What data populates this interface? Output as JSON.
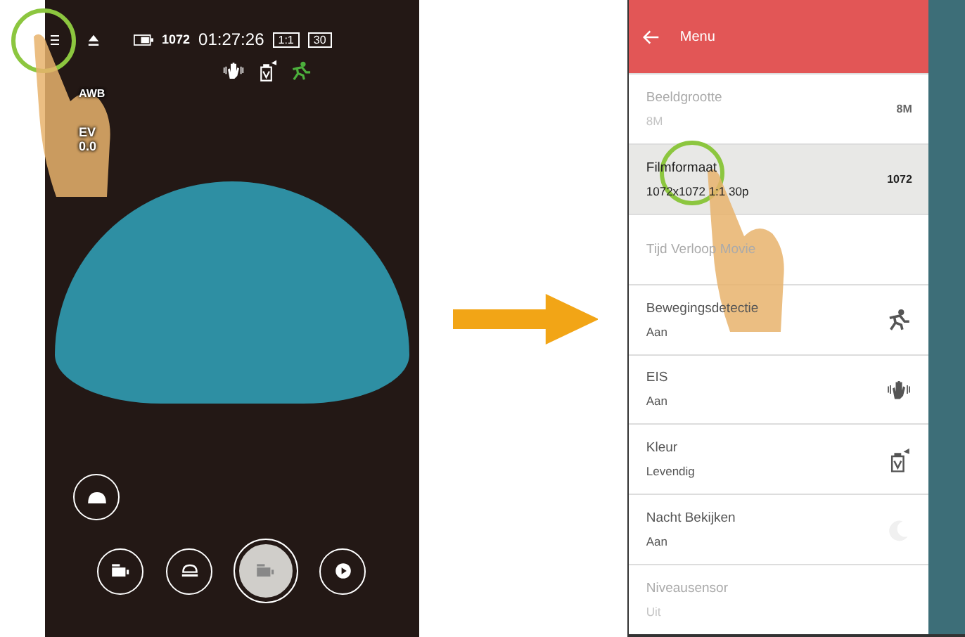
{
  "camera": {
    "status_bar": {
      "resolution": "1072",
      "time": "01:27:26",
      "ratio": "1:1",
      "fps": "30"
    },
    "mode_icons": [
      {
        "kind": "stabilizer"
      },
      {
        "kind": "color"
      },
      {
        "kind": "motion"
      }
    ],
    "awb": "AWB",
    "ev_label": "EV",
    "ev_value": "0.0"
  },
  "menu": {
    "title": "Menu",
    "items": [
      {
        "title": "Beeldgrootte",
        "value": "8M",
        "disabled": true,
        "selected": false,
        "kind": "badge",
        "badge": "8M"
      },
      {
        "title": "Filmformaat",
        "value": "1072x1072 1:1 30p",
        "disabled": false,
        "selected": true,
        "kind": "badge",
        "badge": "1072"
      },
      {
        "title": "Tijd Verloop Movie",
        "disabled": true,
        "selected": false,
        "kind": "plain"
      },
      {
        "title": "Bewegingsdetectie",
        "value": "Aan",
        "disabled": false,
        "selected": false,
        "kind": "motion"
      },
      {
        "title": "EIS",
        "value": "Aan",
        "disabled": false,
        "selected": false,
        "kind": "stabilizer"
      },
      {
        "title": "Kleur",
        "value": "Levendig",
        "disabled": false,
        "selected": false,
        "kind": "color"
      },
      {
        "title": "Nacht Bekijken",
        "value": "Aan",
        "disabled": false,
        "selected": false,
        "kind": "night"
      },
      {
        "title": "Niveausensor",
        "value": "Uit",
        "disabled": true,
        "selected": false,
        "kind": "plain"
      }
    ]
  }
}
